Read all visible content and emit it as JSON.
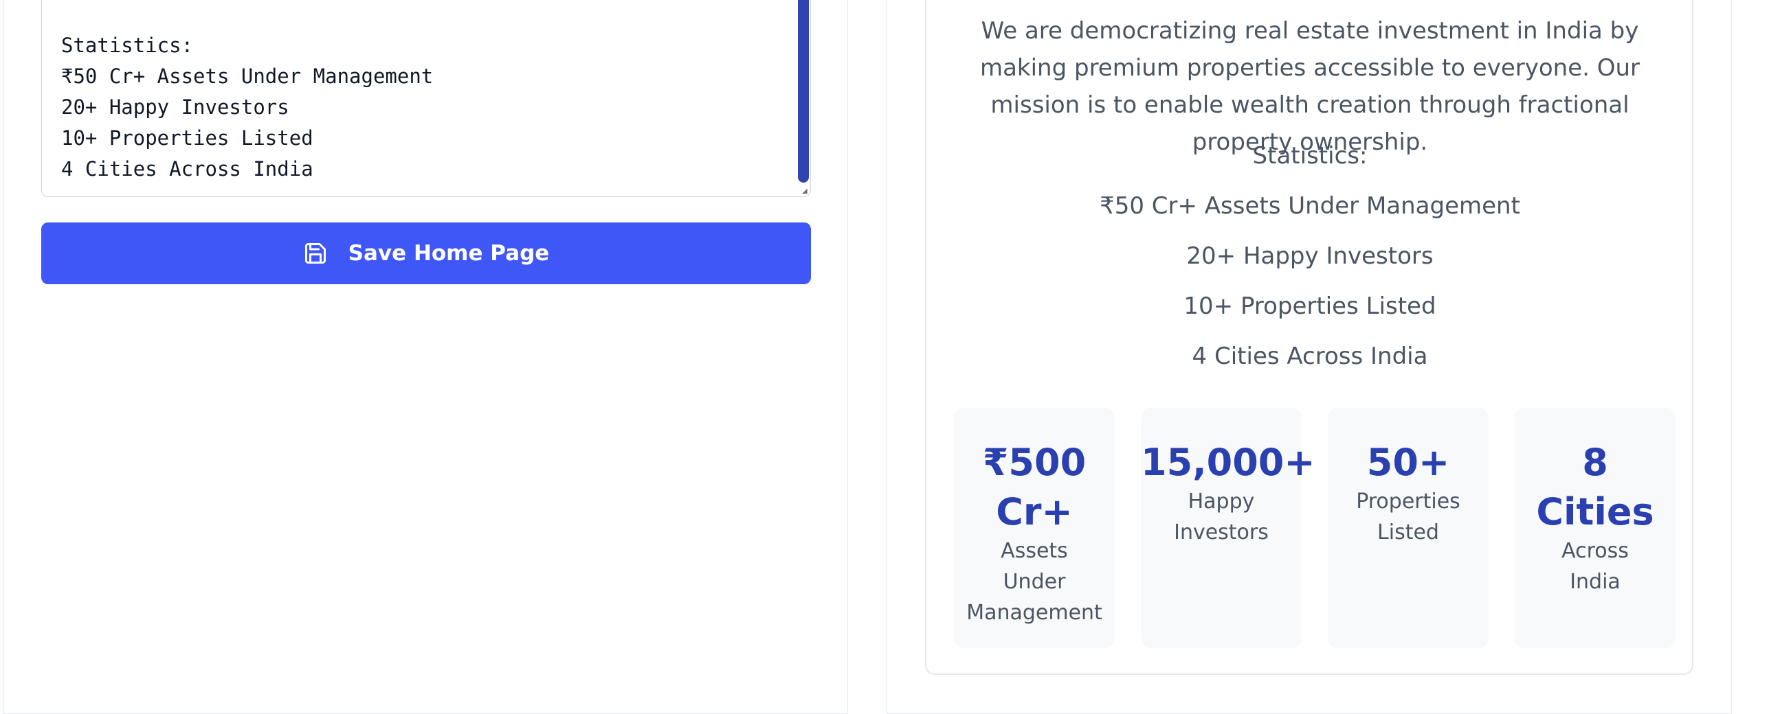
{
  "editor": {
    "lines": [
      "Statistics:",
      "₹50 Cr+ Assets Under Management",
      "20+ Happy Investors",
      "10+ Properties Listed",
      "4 Cities Across India"
    ],
    "save_button_label": "Save Home Page",
    "save_icon": "floppy-disk-icon",
    "accent_color": "#4057f7"
  },
  "preview": {
    "mission_text": "We are democratizing real estate investment in India by making premium properties accessible to everyone. Our mission is to enable wealth creation through fractional property ownership.",
    "statistics_heading": "Statistics:",
    "statistics_lines": [
      "₹50 Cr+ Assets Under Management",
      "20+ Happy Investors",
      "10+ Properties Listed",
      "4 Cities Across India"
    ],
    "stat_cards": [
      {
        "value_lines": [
          "₹500",
          "Cr+"
        ],
        "label_lines": [
          "Assets",
          "Under",
          "Management"
        ]
      },
      {
        "value_lines": [
          "15,000+"
        ],
        "label_lines": [
          "Happy",
          "Investors"
        ]
      },
      {
        "value_lines": [
          "50+"
        ],
        "label_lines": [
          "Properties",
          "Listed"
        ]
      },
      {
        "value_lines": [
          "8",
          "Cities"
        ],
        "label_lines": [
          "Across",
          "India"
        ]
      }
    ],
    "stat_value_color": "#2a3fb0"
  }
}
